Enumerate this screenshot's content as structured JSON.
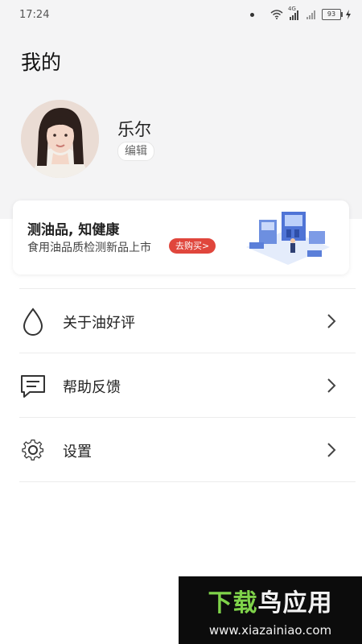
{
  "status_bar": {
    "time": "17:24",
    "network_label": "4G",
    "battery": "93"
  },
  "header": {
    "title": "我的"
  },
  "profile": {
    "name": "乐尔",
    "edit_label": "编辑"
  },
  "banner": {
    "title": "测油品, 知健康",
    "subtitle": "食用油品质检测新品上市",
    "button_label": "去购买>"
  },
  "menu": {
    "items": [
      {
        "label": "关于油好评",
        "icon": "drop-icon"
      },
      {
        "label": "帮助反馈",
        "icon": "feedback-icon"
      },
      {
        "label": "设置",
        "icon": "gear-icon"
      }
    ]
  },
  "watermark": {
    "title_part1": "下载",
    "title_part2": "鸟应用",
    "url": "www.xiazainiao.com"
  },
  "colors": {
    "header_bg": "#f4f4f5",
    "accent_red": "#e0463c",
    "watermark_green": "#7fd34a"
  }
}
